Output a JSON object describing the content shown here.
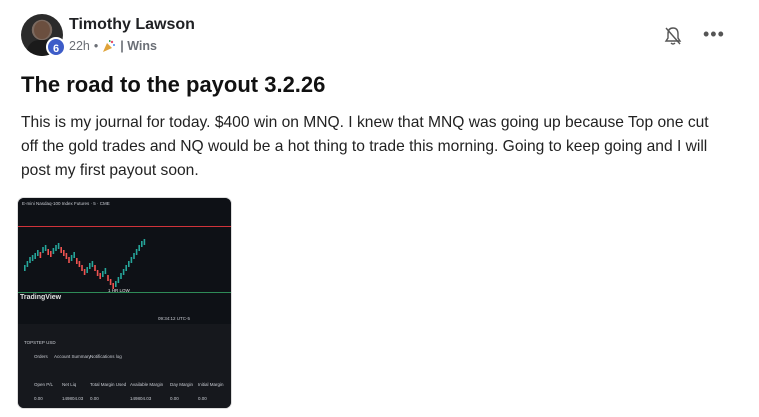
{
  "post": {
    "author": "Timothy Lawson",
    "level": "6",
    "time": "22h",
    "separator": "•",
    "category": "| Wins",
    "title": "The road to the payout 3.2.26",
    "body": "This is my journal for today. $400 win on MNQ. I knew that MNQ was going up because Top one cut off the gold trades and NQ would be a hot thing to trade this morning. Going to keep going and I will post my first payout soon."
  },
  "icons": {
    "bell": "bell-slash-icon",
    "more": "more-dots-icon",
    "category": "party-popper-icon"
  },
  "screenshot": {
    "header": "E-mini Nasdaq-100 Index Futures · 5 · CME",
    "brand": "TradingView",
    "low_label": "1 HR LOW",
    "tabs": [
      "Orders",
      "Account Summary",
      "Notifications log"
    ],
    "account": "TOPSTEP USD",
    "cols": [
      "Open P/L",
      "Net Liq",
      "Total Margin Used",
      "Available Margin",
      "Day Margin",
      "Initial Margin"
    ],
    "vals": [
      "0.00",
      "149804.03",
      "0.00",
      "149804.03",
      "0.00",
      "0.00"
    ],
    "time_readout": "09:34:12 UTC-5"
  },
  "colors": {
    "badge": "#3d5cc8",
    "chart_bg": "#0e1116",
    "up": "#26a69a",
    "down": "#ef5350"
  }
}
